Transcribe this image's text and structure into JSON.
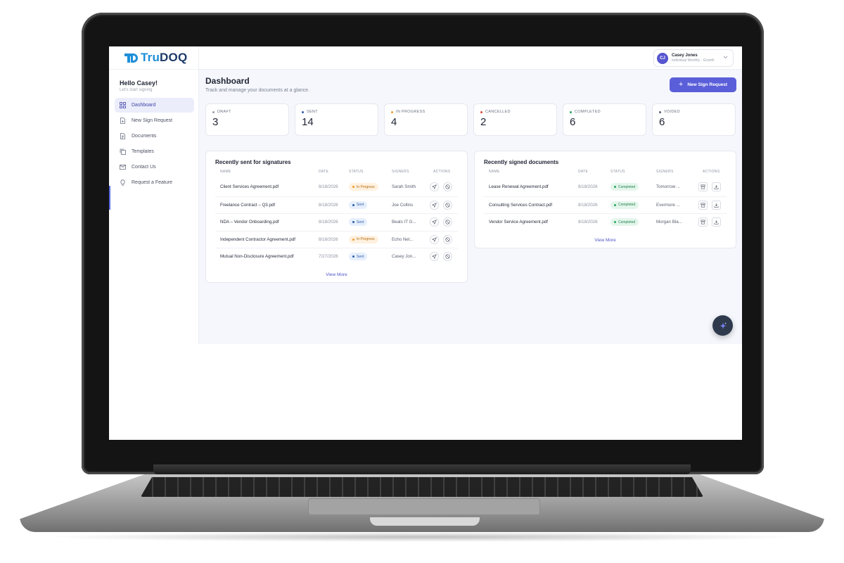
{
  "brand": {
    "logo_tru": "Tru",
    "logo_doq": "DOQ"
  },
  "sidebar": {
    "greeting": "Hello Casey!",
    "subtitle": "Let's start signing",
    "items": [
      {
        "label": "Dashboard",
        "icon": "grid-icon",
        "active": true
      },
      {
        "label": "New Sign Request",
        "icon": "file-plus-icon"
      },
      {
        "label": "Documents",
        "icon": "document-icon"
      },
      {
        "label": "Templates",
        "icon": "copy-icon"
      },
      {
        "label": "Contact Us",
        "icon": "mail-icon"
      },
      {
        "label": "Request a Feature",
        "icon": "lightbulb-icon"
      }
    ]
  },
  "user": {
    "initials": "CJ",
    "name": "Casey Jones",
    "plan": "Individual Monthly - Growth"
  },
  "page": {
    "title": "Dashboard",
    "subtitle": "Track and manage your documents at a glance.",
    "new_button": "New Sign Request"
  },
  "stats": [
    {
      "label": "DRAFT",
      "value": "3",
      "color": "#9aa0ad"
    },
    {
      "label": "SENT",
      "value": "14",
      "color": "#2e5ea8"
    },
    {
      "label": "IN PROGRESS",
      "value": "4",
      "color": "#f29a2e"
    },
    {
      "label": "CANCELLED",
      "value": "2",
      "color": "#e0453b"
    },
    {
      "label": "COMPLETED",
      "value": "6",
      "color": "#2aa55e"
    },
    {
      "label": "VOIDED",
      "value": "6",
      "color": "#5b6070"
    }
  ],
  "recent_sent": {
    "title": "Recently sent for signatures",
    "columns": [
      "NAME",
      "DATE",
      "STATUS",
      "SIGNERS",
      "ACTIONS"
    ],
    "rows": [
      {
        "name": "Client Services Agreement.pdf",
        "date": "8/18/2026",
        "status": "In Progress",
        "signer": "Sarah Smith"
      },
      {
        "name": "Freelance Contract – Q3.pdf",
        "date": "8/18/2026",
        "status": "Sent",
        "signer": "Joe Collins"
      },
      {
        "name": "NDA – Vendor Onboarding.pdf",
        "date": "8/18/2026",
        "status": "Sent",
        "signer": "Beats IT G..."
      },
      {
        "name": "Independent Contractor Agreement.pdf",
        "date": "8/18/2026",
        "status": "In Progress",
        "signer": "Echo Net..."
      },
      {
        "name": "Mutual Non-Disclosure Agreement.pdf",
        "date": "7/27/2026",
        "status": "Sent",
        "signer": "Casey Jon..."
      }
    ],
    "view_more": "View More"
  },
  "recent_signed": {
    "title": "Recently signed documents",
    "columns": [
      "NAME",
      "DATE",
      "STATUS",
      "SIGNERS",
      "ACTIONS"
    ],
    "rows": [
      {
        "name": "Lease Renewal Agreement.pdf",
        "date": "8/18/2026",
        "status": "Completed",
        "signer": "Tomorrow ..."
      },
      {
        "name": "Consulting Services Contract.pdf",
        "date": "8/18/2026",
        "status": "Completed",
        "signer": "Evermore ..."
      },
      {
        "name": "Vendor Service Agreement.pdf",
        "date": "8/18/2026",
        "status": "Completed",
        "signer": "Morgan Bla..."
      }
    ],
    "view_more": "View More"
  },
  "colors": {
    "accent": "#5a5ed9",
    "brand_blue": "#1d8fd8",
    "fab": "#2e3a4c"
  }
}
